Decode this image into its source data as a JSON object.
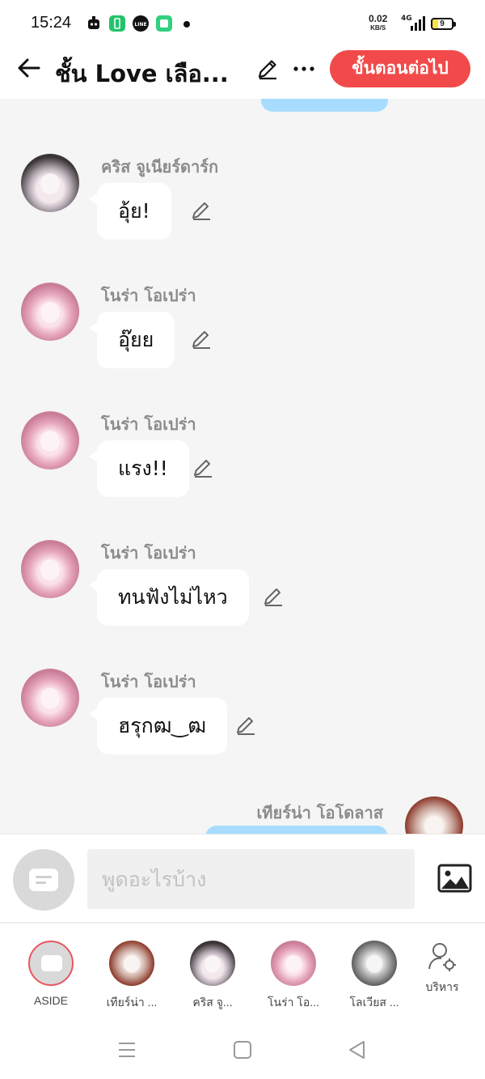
{
  "status_bar": {
    "time": "15:24",
    "net_speed_value": "0.02",
    "net_speed_unit": "KB/S",
    "network": "4G",
    "battery": "9",
    "notification_icons": [
      "bot-icon",
      "battery-app-icon",
      "line-icon",
      "app-icon",
      "dot"
    ]
  },
  "header": {
    "title": "ชั้น Love เลือ...",
    "next_button": "ขั้นตอนต่อไป"
  },
  "messages": [
    {
      "name": "คริส จูเนียร์ดาร์ก",
      "text": "อุ้ย!",
      "avatar": "dark"
    },
    {
      "name": "โนร่า โอเปร่า",
      "text": "อุ๊ยย",
      "avatar": "pink"
    },
    {
      "name": "โนร่า โอเปร่า",
      "text": "แรง!!",
      "avatar": "pink"
    },
    {
      "name": "โนร่า โอเปร่า",
      "text": "ทนฟังไม่ไหว",
      "avatar": "pink"
    },
    {
      "name": "โนร่า โอเปร่า",
      "text": "ฮรุกฒ‿ฒ",
      "avatar": "pink"
    }
  ],
  "outgoing": {
    "name": "เทียร์น่า โอโดลาส"
  },
  "input": {
    "placeholder": "พูดอะไรบ้าง"
  },
  "cast": [
    {
      "label": "ASIDE"
    },
    {
      "label": "เทียร์น่า ..."
    },
    {
      "label": "คริส จู..."
    },
    {
      "label": "โนร่า โอ..."
    },
    {
      "label": "โลเวียส ..."
    },
    {
      "label": "บริหาร"
    }
  ],
  "colors": {
    "accent": "#f24a4a",
    "outgoing_bubble": "#a8dcff",
    "background": "#f5f5f5"
  }
}
